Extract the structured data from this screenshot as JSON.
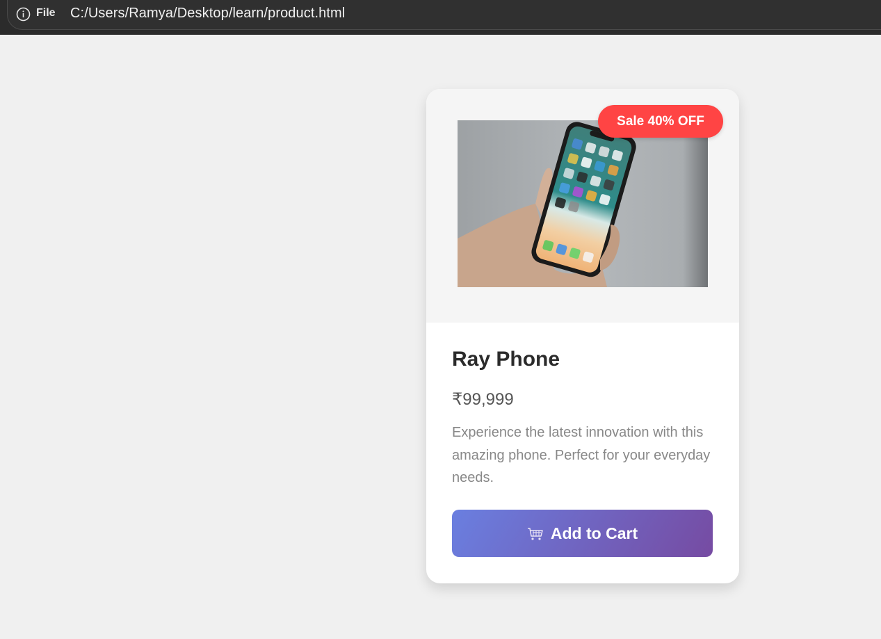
{
  "browser": {
    "file_label": "File",
    "url": "C:/Users/Ramya/Desktop/learn/product.html",
    "icons": {
      "info": "info-icon"
    }
  },
  "product": {
    "badge": "Sale 40% OFF",
    "name": "Ray Phone",
    "price": "₹99,999",
    "description": "Experience the latest innovation with this amazing phone. Perfect for your everyday needs.",
    "add_to_cart_label": "Add to Cart",
    "icons": {
      "cart": "shopping-cart-icon"
    }
  },
  "colors": {
    "badge": "#ff4444",
    "button_gradient_start": "#6a7fe0",
    "button_gradient_end": "#764ba2",
    "page_background": "#f0f0f0"
  }
}
